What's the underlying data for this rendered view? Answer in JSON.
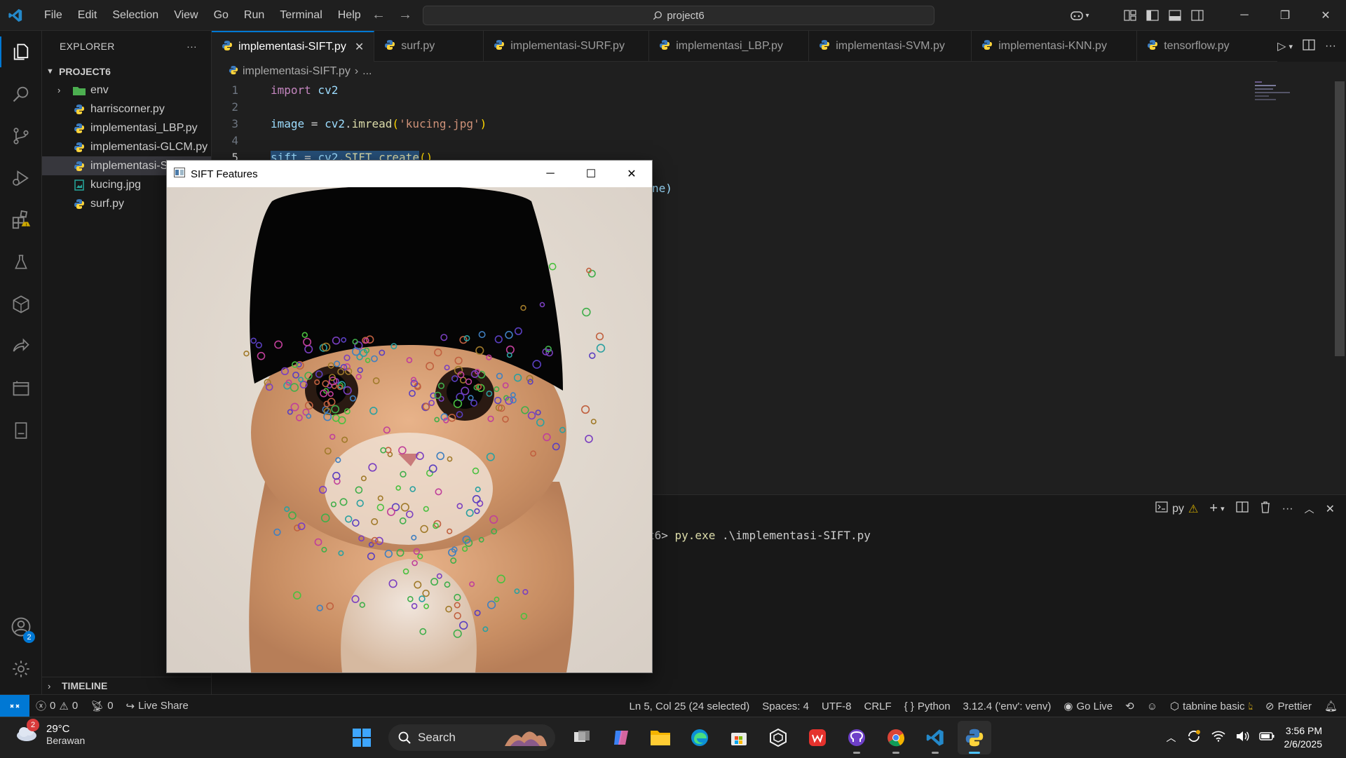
{
  "menu": [
    "File",
    "Edit",
    "Selection",
    "View",
    "Go",
    "Run",
    "Terminal",
    "Help"
  ],
  "command_center": "project6",
  "explorer": {
    "title": "EXPLORER",
    "project": "PROJECT6",
    "items": [
      {
        "name": "env",
        "type": "folder"
      },
      {
        "name": "harriscorner.py",
        "type": "py"
      },
      {
        "name": "implementasi_LBP.py",
        "type": "py"
      },
      {
        "name": "implementasi-GLCM.py",
        "type": "py"
      },
      {
        "name": "implementasi-SIFT.py",
        "type": "py",
        "selected": true
      },
      {
        "name": "kucing.jpg",
        "type": "img"
      },
      {
        "name": "surf.py",
        "type": "py"
      }
    ],
    "timeline": "TIMELINE"
  },
  "tabs": [
    "implementasi-SIFT.py",
    "surf.py",
    "implementasi-SURF.py",
    "implementasi_LBP.py",
    "implementasi-SVM.py",
    "implementasi-KNN.py",
    "tensorflow.py"
  ],
  "breadcrumb": {
    "file": "implementasi-SIFT.py",
    "rest": "..."
  },
  "code": {
    "l1": {
      "n": "1",
      "kw": "import",
      "id": " cv2"
    },
    "l2": {
      "n": "2"
    },
    "l3": {
      "n": "3",
      "a": "image",
      "b": " = ",
      "c": "cv2",
      "d": ".",
      "e": "imread",
      "f": "(",
      "g": "'kucing.jpg'",
      "h": ")"
    },
    "l4": {
      "n": "4"
    },
    "l5": {
      "n": "5",
      "a": "sift",
      "b": " = ",
      "c": "cv2",
      "d": ".",
      "e": "SIFT_create",
      "f": "()"
    },
    "l6_tail": "ne)"
  },
  "terminal": {
    "prompt_tail": "t6> ",
    "cmd": "py.exe",
    "args": " .\\implementasi-SIFT.py",
    "shell_label": "py"
  },
  "status": {
    "errors": "0",
    "warnings": "0",
    "ports": "0",
    "live_share": "Live Share",
    "position": "Ln 5, Col 25 (24 selected)",
    "spaces": "Spaces: 4",
    "encoding": "UTF-8",
    "eol": "CRLF",
    "lang": "Python",
    "interpreter": "3.12.4 ('env': venv)",
    "golive": "Go Live",
    "tabnine": "tabnine basic",
    "prettier": "Prettier"
  },
  "accounts_badge": "2",
  "cv_window": {
    "title": "SIFT Features"
  },
  "taskbar": {
    "temp": "29°C",
    "weather": "Berawan",
    "weather_badge": "2",
    "search": "Search",
    "time": "3:56 PM",
    "date": "2/6/2025"
  },
  "colors": {
    "accent": "#0078d4",
    "editor_bg": "#1f1f1f",
    "sidebar_bg": "#181818"
  }
}
